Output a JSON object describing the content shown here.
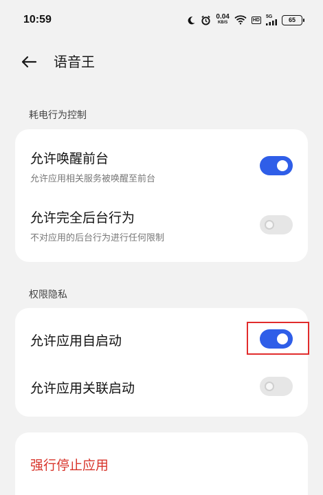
{
  "status": {
    "time": "10:59",
    "speed_value": "0.04",
    "speed_unit": "KB/S",
    "hd": "HD",
    "network": "5G",
    "battery": "65"
  },
  "header": {
    "title": "语音王"
  },
  "sections": {
    "power": {
      "label": "耗电行为控制",
      "items": [
        {
          "title": "允许唤醒前台",
          "subtitle": "允许应用相关服务被唤醒至前台",
          "enabled": true
        },
        {
          "title": "允许完全后台行为",
          "subtitle": "不对应用的后台行为进行任何限制",
          "enabled": false
        }
      ]
    },
    "privacy": {
      "label": "权限隐私",
      "items": [
        {
          "title": "允许应用自启动",
          "enabled": true
        },
        {
          "title": "允许应用关联启动",
          "enabled": false
        }
      ]
    }
  },
  "actions": {
    "force_stop": "强行停止应用"
  },
  "colors": {
    "accent": "#2f5ee8",
    "danger": "#d8352b",
    "highlight": "#e12b2b"
  }
}
